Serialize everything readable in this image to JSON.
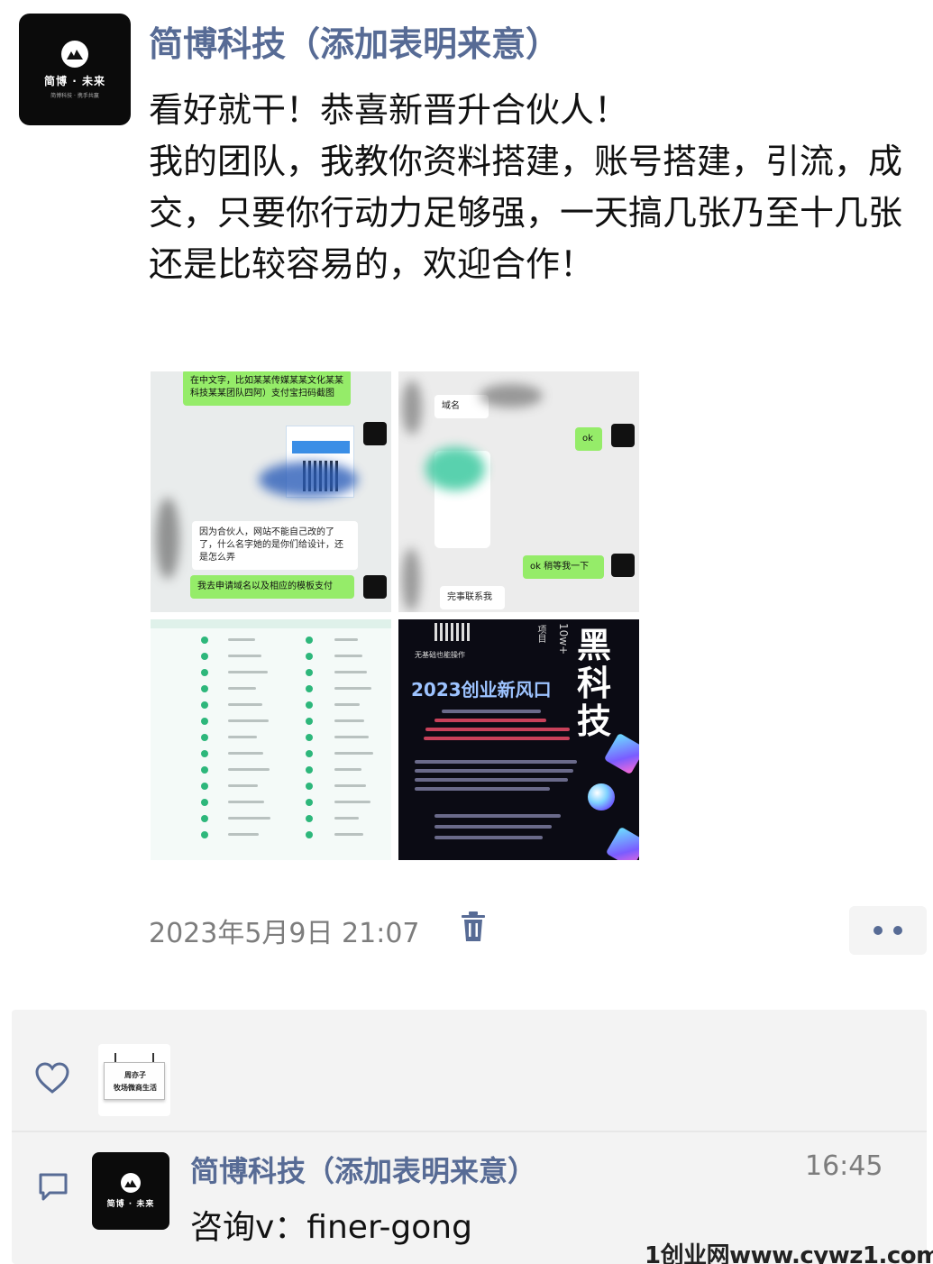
{
  "post": {
    "author": "简博科技（添加表明来意）",
    "text": "看好就干！恭喜新晋升合伙人！\n我的团队，我教你资料搭建，账号搭建，引流，成交，只要你行动力足够强，一天搞几张乃至十几张还是比较容易的，欢迎合作！",
    "avatar_logo": {
      "name": "简博 · 未来",
      "tagline": "简博科技 · 携手共赢"
    },
    "images": [
      {
        "label": "chat-screenshot-1",
        "bubbles": [
          "在中文字，比如某某传媒某某文化某某科技某某团队四阿）支付宝扫码截图",
          "因为合伙人，网站不能自己改的了了，什么名字她的是你们给设计，还是怎么弄",
          "我去申请域名以及相应的模板支付"
        ]
      },
      {
        "label": "chat-screenshot-2",
        "bubbles": [
          "域名",
          "ok",
          "ok 稍等我一下",
          "完事联系我"
        ]
      },
      {
        "label": "list-screenshot"
      },
      {
        "label": "poster",
        "big_text": "黑科技",
        "side_text": "10w+",
        "side_small": "项目",
        "title": "2023创业新风口",
        "subtitle": "无基础也能操作"
      }
    ],
    "timestamp": "2023年5月9日 21:07",
    "delete_icon": "trash-icon",
    "more_icon": "more-dots-icon"
  },
  "likes": {
    "icon": "heart-icon",
    "liker_sign": [
      "周亦子",
      "牧场微商生活"
    ]
  },
  "comment": {
    "icon": "comment-icon",
    "avatar_logo": {
      "name": "简博 · 未来"
    },
    "author": "简博科技（添加表明来意）",
    "time": "16:45",
    "text": "咨询v：finer-gong"
  },
  "watermark": "1创业网www.cywz1.com",
  "colors": {
    "link_blue": "#576b95",
    "panel_gray": "#f3f3f3",
    "wechat_green": "#95ec69"
  }
}
